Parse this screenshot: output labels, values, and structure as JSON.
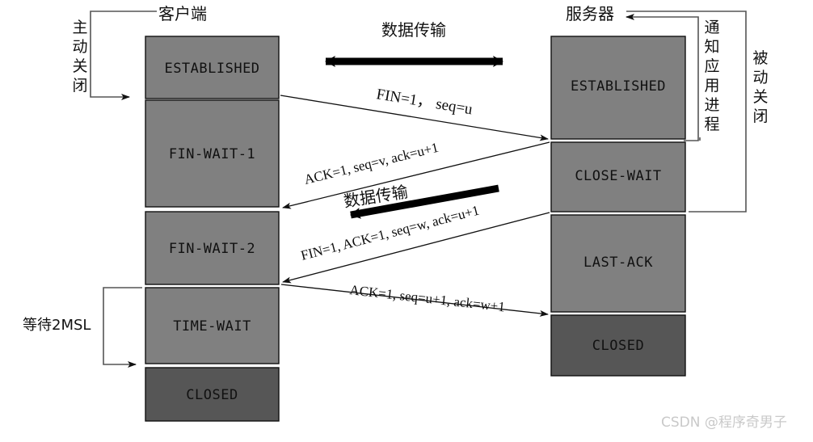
{
  "diagram": {
    "title_left": "客户端",
    "title_right": "服务器",
    "annotations": {
      "active_close": "主动关闭",
      "passive_close": "被动关闭",
      "notify_app": "通知应用进程",
      "wait_2msl": "等待2MSL"
    },
    "data_transfer_top": "数据传输",
    "data_transfer_mid": "数据传输",
    "client_states": [
      {
        "label": "ESTABLISHED",
        "fill": "#808080"
      },
      {
        "label": "FIN-WAIT-1",
        "fill": "#808080"
      },
      {
        "label": "FIN-WAIT-2",
        "fill": "#808080"
      },
      {
        "label": "TIME-WAIT",
        "fill": "#808080"
      },
      {
        "label": "CLOSED",
        "fill": "#565656"
      }
    ],
    "server_states": [
      {
        "label": "ESTABLISHED",
        "fill": "#808080"
      },
      {
        "label": "CLOSE-WAIT",
        "fill": "#808080"
      },
      {
        "label": "LAST-ACK",
        "fill": "#808080"
      },
      {
        "label": "CLOSED",
        "fill": "#565656"
      }
    ],
    "messages": [
      {
        "id": "fin1",
        "text": "FIN=1，  seq=u",
        "direction": "client-to-server"
      },
      {
        "id": "ack1",
        "text": "ACK=1, seq=v, ack=u+1",
        "direction": "server-to-client"
      },
      {
        "id": "fin2",
        "text": "FIN=1,  ACK=1,  seq=w, ack=u+1",
        "direction": "server-to-client"
      },
      {
        "id": "ack2",
        "text": "ACK=1, seq=u+1, ack=w+1",
        "direction": "client-to-server"
      }
    ],
    "watermark": "CSDN @程序奇男子",
    "colors": {
      "box_fill": "#808080",
      "box_fill_closed": "#565656",
      "stroke": "#111111",
      "bracket": "#555555",
      "watermark": "#c9c9c9"
    }
  }
}
